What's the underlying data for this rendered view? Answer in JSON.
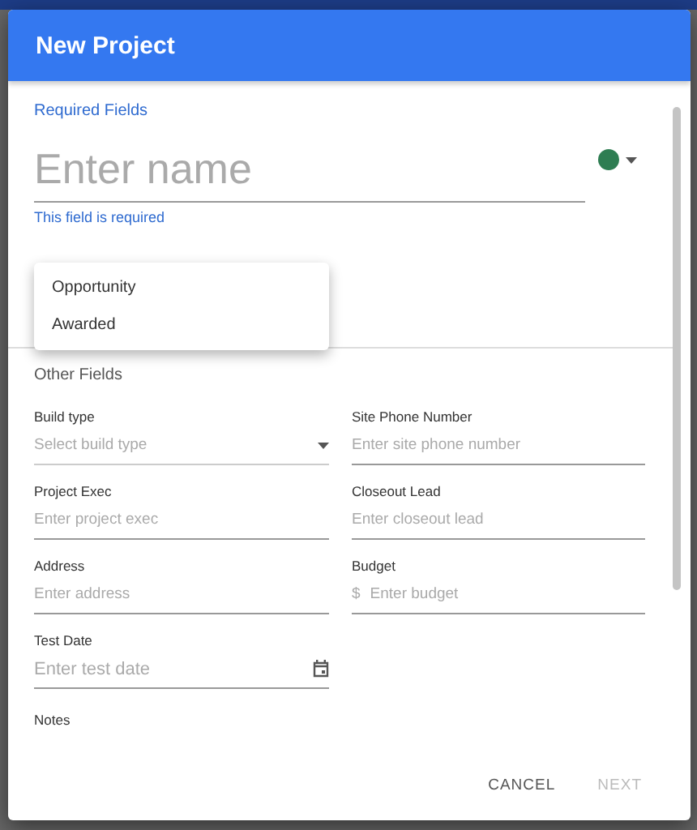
{
  "dialog": {
    "title": "New Project"
  },
  "required_section": {
    "heading": "Required Fields",
    "name_field": {
      "placeholder": "Enter name",
      "error": "This field is required",
      "color": "#2e7d52"
    }
  },
  "type_menu": {
    "options": [
      {
        "label": "Opportunity",
        "selected": false
      },
      {
        "label": "Awarded",
        "selected": false
      }
    ]
  },
  "other_section": {
    "heading": "Other Fields",
    "fields": [
      {
        "kind": "select",
        "label": "Build type",
        "placeholder": "Select build type"
      },
      {
        "kind": "text",
        "label": "Site Phone Number",
        "placeholder": "Enter site phone number"
      },
      {
        "kind": "text",
        "label": "Project Exec",
        "placeholder": "Enter project exec"
      },
      {
        "kind": "text",
        "label": "Closeout Lead",
        "placeholder": "Enter closeout lead"
      },
      {
        "kind": "text",
        "label": "Address",
        "placeholder": "Enter address"
      },
      {
        "kind": "currency",
        "label": "Budget",
        "prefix": "$",
        "placeholder": "Enter budget"
      },
      {
        "kind": "date",
        "label": "Test Date",
        "placeholder": "Enter test date"
      }
    ],
    "notes_label": "Notes"
  },
  "buttons": [
    {
      "label": "CANCEL",
      "disabled": false
    },
    {
      "label": "NEXT",
      "disabled": true
    }
  ]
}
